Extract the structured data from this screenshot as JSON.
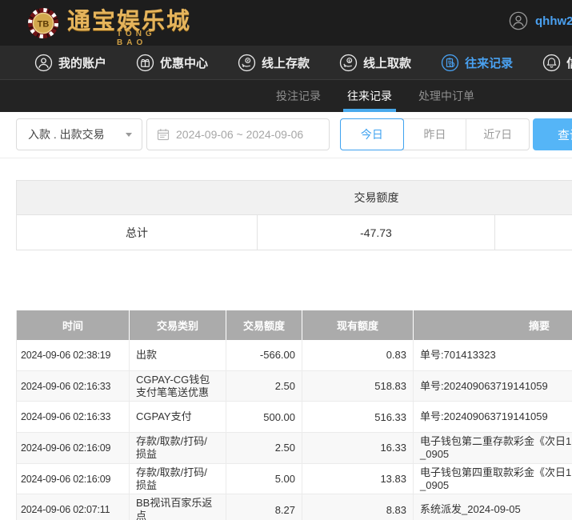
{
  "topbar": {
    "brand_tb": "TB",
    "brand_cn": "通宝娱乐城",
    "brand_en": "TONG BAO",
    "username": "qhhw2",
    "user_icon": "user-avatar-icon"
  },
  "nav": {
    "items": [
      {
        "id": "account",
        "label": "我的账户",
        "icon": "user-icon",
        "active": false
      },
      {
        "id": "promo",
        "label": "优惠中心",
        "icon": "gift-icon",
        "active": false
      },
      {
        "id": "deposit",
        "label": "线上存款",
        "icon": "deposit-icon",
        "active": false
      },
      {
        "id": "withdraw",
        "label": "线上取款",
        "icon": "withdraw-icon",
        "active": false
      },
      {
        "id": "records",
        "label": "往来记录",
        "icon": "records-icon",
        "active": true
      },
      {
        "id": "notice",
        "label": "信息",
        "icon": "bell-icon",
        "active": false
      }
    ]
  },
  "tabs": {
    "items": [
      {
        "id": "bets",
        "label": "投注记录",
        "active": false
      },
      {
        "id": "records",
        "label": "往来记录",
        "active": true
      },
      {
        "id": "processing",
        "label": "处理中订单",
        "active": false
      }
    ]
  },
  "filters": {
    "type_value": "入款 . 出款交易",
    "type_caret_icon": "caret-down-icon",
    "date_icon": "calendar-icon",
    "date_value": "2024-09-06 ~ 2024-09-06",
    "quick_buttons": [
      {
        "label": "今日",
        "active": true
      },
      {
        "label": "昨日",
        "active": false
      },
      {
        "label": "近7日",
        "active": false
      }
    ],
    "search_label": "查询"
  },
  "summary": {
    "title": "交易额度",
    "total_label": "总计",
    "total_value": "-47.73"
  },
  "table": {
    "headers": [
      "时间",
      "交易类别",
      "交易额度",
      "现有额度",
      "摘要"
    ],
    "rows": [
      {
        "time": "2024-09-06 02:38:19",
        "type": "出款",
        "amount": "-566.00",
        "balance": "0.83",
        "summary": "单号:701413323",
        "shade": false
      },
      {
        "time": "2024-09-06 02:16:33",
        "type": "CGPAY-CG钱包\n支付笔笔送优惠",
        "amount": "2.50",
        "balance": "518.83",
        "summary": "单号:202409063719141059",
        "shade": true
      },
      {
        "time": "2024-09-06 02:16:33",
        "type": "CGPAY支付",
        "amount": "500.00",
        "balance": "516.33",
        "summary": "单号:202409063719141059",
        "shade": false
      },
      {
        "time": "2024-09-06 02:16:09",
        "type": "存款/取款/打码/\n损益",
        "amount": "2.50",
        "balance": "16.33",
        "summary": "电子钱包第二重存款彩金《次日1\n_0905",
        "shade": true
      },
      {
        "time": "2024-09-06 02:16:09",
        "type": "存款/取款/打码/\n损益",
        "amount": "5.00",
        "balance": "13.83",
        "summary": "电子钱包第四重取款彩金《次日1\n_0905",
        "shade": false
      },
      {
        "time": "2024-09-06 02:07:11",
        "type": "BB视讯百家乐返\n点",
        "amount": "8.27",
        "balance": "8.83",
        "summary": "系统派发_2024-09-05",
        "shade": true
      }
    ]
  },
  "colors": {
    "accent_blue": "#49a1f1",
    "tab_underline_blue": "#49a9ec",
    "search_button_blue": "#55b5f7",
    "table_header_gray": "#ababab",
    "brand_gold": "#e5b45c",
    "topbar_dark": "#1d1d1d",
    "navbar_dark": "#2b2b2b",
    "tabbar_dark": "#232323"
  }
}
